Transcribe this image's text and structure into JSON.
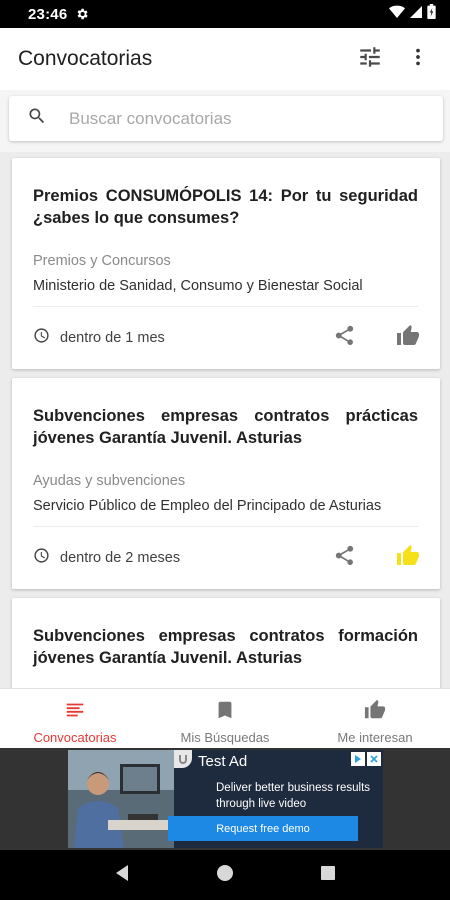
{
  "status_bar": {
    "time": "23:46"
  },
  "app_bar": {
    "title": "Convocatorias",
    "filter_icon": "tune-icon",
    "menu_icon": "more-vert-icon"
  },
  "search": {
    "placeholder": "Buscar convocatorias",
    "icon": "search-icon"
  },
  "cards": [
    {
      "title": "Premios CONSUMÓPOLIS 14: Por tu seguridad ¿sabes lo que consumes?",
      "category": "Premios y Concursos",
      "organization": "Ministerio de Sanidad, Consumo y Bienestar Social",
      "deadline": "dentro de 1 mes",
      "liked": false
    },
    {
      "title": "Subvenciones empresas contratos prácticas jóvenes Garantía Juvenil. Asturias",
      "category": "Ayudas y subvenciones",
      "organization": "Servicio Público de Empleo del Principado de Asturias",
      "deadline": "dentro de 2 meses",
      "liked": true
    },
    {
      "title": "Subvenciones empresas contratos formación jóvenes Garantía Juvenil. Asturias"
    }
  ],
  "bottom_nav": [
    {
      "label": "Convocatorias",
      "icon": "list-icon",
      "active": true
    },
    {
      "label": "Mis Búsquedas",
      "icon": "bookmark-icon",
      "active": false
    },
    {
      "label": "Me interesan",
      "icon": "thumb-up-icon",
      "active": false
    }
  ],
  "ad": {
    "label": "Test Ad",
    "headline": "Deliver better business results through live video",
    "cta": "Request free demo"
  },
  "colors": {
    "accent": "#e53935",
    "liked": "#f5e11a",
    "icon_grey": "#757575",
    "ad_cta": "#1e88e5"
  }
}
